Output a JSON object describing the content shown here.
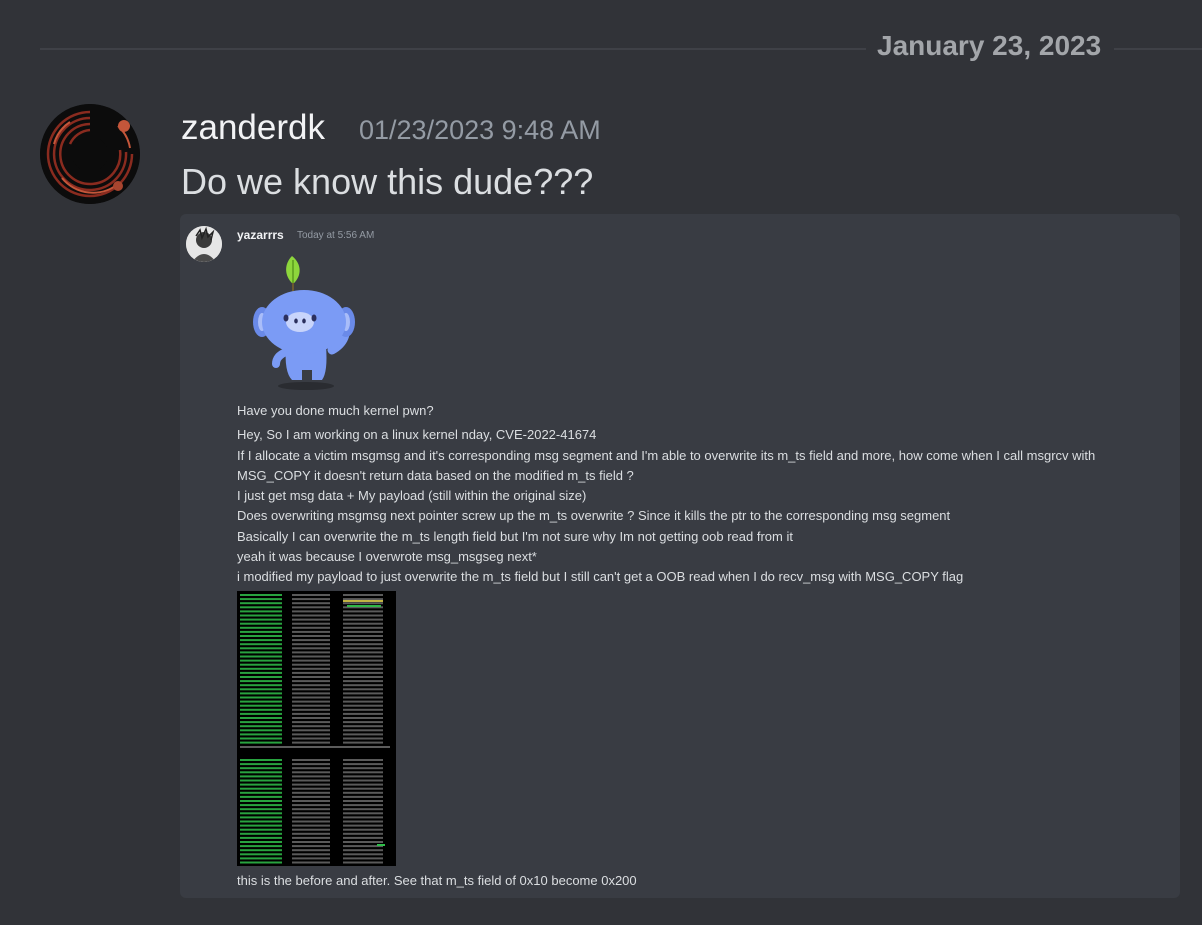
{
  "date_divider": {
    "label": "January 23, 2023"
  },
  "message": {
    "author": "zanderdk",
    "timestamp": "01/23/2023 9:48 AM",
    "text": "Do we know this dude???"
  },
  "embedded_screenshot": {
    "author": "yazarrrs",
    "timestamp": "Today at 5:56 AM",
    "sticker_icon": "wumpus-waving-sticker",
    "lines": [
      "Have you done much kernel pwn?",
      "Hey, So I am working on a linux kernel nday, CVE-2022-41674",
      "If I allocate a victim msgmsg and it's corresponding msg segment and I'm able to overwrite its m_ts field and more, how come when I call msgrcv with",
      "MSG_COPY it doesn't return data based on the modified m_ts field ?",
      "I just get msg data + My payload (still within the original size)",
      "Does overwriting msgmsg next pointer screw up the m_ts overwrite ? Since it kills the ptr to the corresponding msg segment",
      "Basically I can overwrite the m_ts length field but I'm not sure why Im not getting oob read from it",
      "yeah it was because I overwrote msg_msgseg next*",
      "i modified my payload to just overwrite the m_ts field but I still can't get a OOB read when I do recv_msg with MSG_COPY flag"
    ],
    "caption": "this is the before and after. See that m_ts field of 0x10 become 0x200"
  },
  "colors": {
    "background": "#313338",
    "embed_background": "#393c43",
    "primary_text": "#dbdee1",
    "muted_text": "#949ba4",
    "terminal_green": "#2fbf4a"
  }
}
